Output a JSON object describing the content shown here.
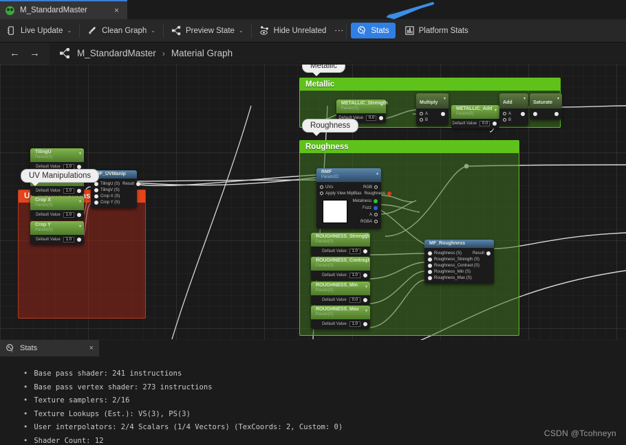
{
  "tab": {
    "title": "M_StandardMaster",
    "close": "×",
    "icon": "material-asset-icon"
  },
  "toolbar": {
    "items": [
      {
        "label": "Live Update",
        "icon": "live-update-icon",
        "caret": "⌄"
      },
      {
        "label": "Clean Graph",
        "icon": "broom-icon",
        "caret": "⌄"
      },
      {
        "label": "Preview State",
        "icon": "node-graph-icon",
        "caret": "⌄"
      },
      {
        "label": "Hide Unrelated",
        "icon": "hide-unrelated-icon",
        "caret": ""
      }
    ],
    "overflow": "⋮",
    "stats_button": {
      "label": "Stats",
      "icon": "stats-icon",
      "accent": "#2f7fe4"
    },
    "platform_stats": {
      "label": "Platform Stats",
      "icon": "platform-stats-icon"
    }
  },
  "breadcrumb": {
    "back": "←",
    "forward": "→",
    "icon": "material-graph-icon",
    "root": "M_StandardMaster",
    "separator": "›",
    "current": "Material Graph"
  },
  "graph": {
    "bubbles": [
      {
        "label": "UV Manipulations"
      },
      {
        "label": "Metallic"
      },
      {
        "label": "Roughness"
      }
    ],
    "comments": [
      {
        "title": "UV Manipulations",
        "color": "#e8441a"
      },
      {
        "title": "Metallic",
        "color": "#5fc21a"
      },
      {
        "title": "Roughness",
        "color": "#5fc21a"
      }
    ],
    "uv_params": [
      {
        "title": "TilingU",
        "sub": "Param(S)",
        "value_label": "Default Value",
        "value": "1.0"
      },
      {
        "title": "TilingV",
        "sub": "Param(S)",
        "value_label": "Default Value",
        "value": "1.0"
      },
      {
        "title": "Crop X",
        "sub": "Param(S)",
        "value_label": "Default Value",
        "value": "1.0"
      },
      {
        "title": "Crop Y",
        "sub": "Param(S)",
        "value_label": "Default Value",
        "value": "1.0"
      }
    ],
    "mf_uvmanip": {
      "title": "MF_UVManip",
      "inputs": [
        "TilingU (S)",
        "TilingV (S)",
        "Crop X (S)",
        "Crop Y (S)"
      ],
      "output": "Result"
    },
    "metallic_strength": {
      "title": "METALLIC_Strength",
      "sub": "Param(S)",
      "value_label": "Default Value",
      "value": "0.0"
    },
    "metallic_add": {
      "title": "METALLIC_Add",
      "sub": "Param(S)",
      "value_label": "Default Value",
      "value": "0.0"
    },
    "multiply": {
      "title": "Multiply",
      "inputs": [
        "A",
        "B"
      ]
    },
    "add": {
      "title": "Add",
      "inputs": [
        "A",
        "B"
      ]
    },
    "saturate": {
      "title": "Saturate",
      "inputs": [
        ""
      ]
    },
    "rmf_texture": {
      "title": "RMF",
      "sub": "Param2D",
      "inputs": [
        "UVs",
        "Apply View MipBias"
      ],
      "outputs": [
        "RGB",
        "Roughness",
        "Metalness",
        "Fuzz",
        "A",
        "RGBA"
      ]
    },
    "roughness_params": [
      {
        "title": "ROUGHNESS_Strength",
        "sub": "Param(S)",
        "value_label": "Default Value",
        "value": "1.0"
      },
      {
        "title": "ROUGHNESS_Contrast",
        "sub": "Param(S)",
        "value_label": "Default Value",
        "value": "1.0"
      },
      {
        "title": "ROUGHNESS_Min",
        "sub": "Param(S)",
        "value_label": "Default Value",
        "value": "0.0"
      },
      {
        "title": "ROUGHNESS_Max",
        "sub": "Param(S)",
        "value_label": "Default Value",
        "value": "1.0"
      }
    ],
    "mf_roughness": {
      "title": "MF_Roughness",
      "inputs": [
        "Roughness (S)",
        "Roughness_Strength (S)",
        "Roughness_Contrast (S)",
        "Roughness_Min (S)",
        "Roughness_Max (S)"
      ],
      "output": "Result"
    }
  },
  "stats": {
    "tab_title": "Stats",
    "tab_icon": "stats-icon",
    "close": "×",
    "lines": [
      "Base pass shader: 241 instructions",
      "Base pass vertex shader: 273 instructions",
      "Texture samplers: 2/16",
      "Texture Lookups (Est.): VS(3), PS(3)",
      "User interpolators: 2/4 Scalars (1/4 Vectors) (TexCoords: 2, Custom: 0)",
      "Shader Count: 12"
    ]
  },
  "watermark": "CSDN @Tcohneyn"
}
